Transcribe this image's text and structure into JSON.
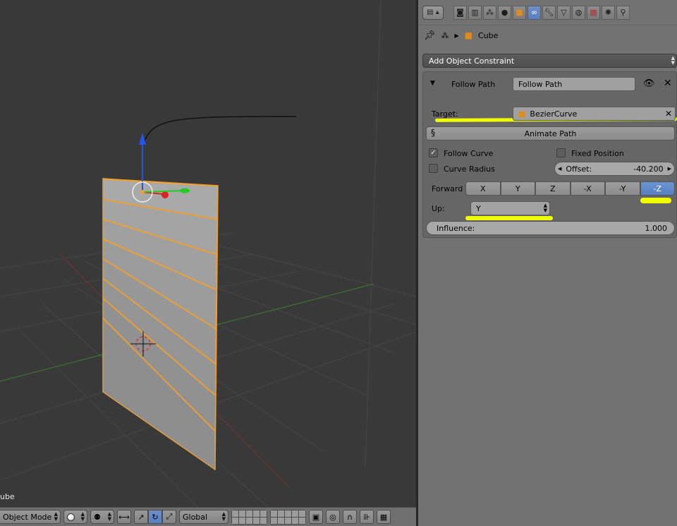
{
  "viewport": {
    "object_label": "ube"
  },
  "viewport_header": {
    "mode": "Object Mode",
    "orientation": "Global"
  },
  "properties": {
    "breadcrumb": {
      "object": "Cube"
    },
    "add_constraint": "Add Object Constraint",
    "constraint": {
      "type_label": "Follow Path",
      "name": "Follow Path",
      "target_label": "Target:",
      "target_value": "BezierCurve",
      "animate_path": "Animate Path",
      "follow_curve": {
        "label": "Follow Curve",
        "checked": true
      },
      "fixed_position": {
        "label": "Fixed Position",
        "checked": false
      },
      "curve_radius": {
        "label": "Curve Radius",
        "checked": false
      },
      "offset": {
        "label": "Offset:",
        "value": "-40.200"
      },
      "forward_label": "Forward",
      "forward_axes": [
        "X",
        "Y",
        "Z",
        "-X",
        "-Y",
        "-Z"
      ],
      "forward_selected": "-Z",
      "up_label": "Up:",
      "up_value": "Y",
      "influence": {
        "label": "Influence:",
        "value": "1.000"
      }
    }
  },
  "colors": {
    "viewport_bg": "#393939",
    "selection_orange": "#f0a030",
    "active_blue": "#5680c2",
    "highlighter_yellow": "#f0ff00"
  }
}
